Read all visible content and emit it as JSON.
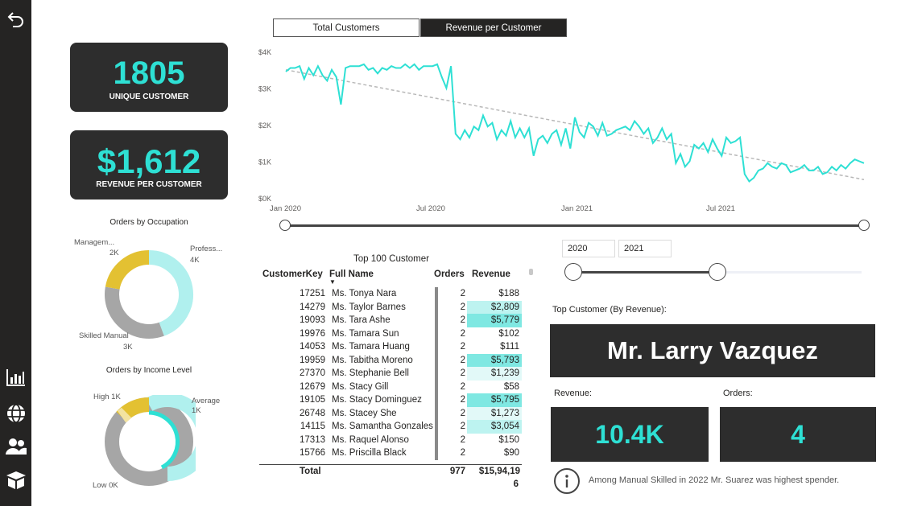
{
  "sidebar": {
    "icons": [
      "back-arrow-icon",
      "bar-chart-icon",
      "globe-icon",
      "users-icon",
      "box-icon"
    ]
  },
  "kpis": {
    "unique_customers": {
      "value": "1805",
      "label": "UNIQUE CUSTOMER"
    },
    "revenue_per_customer": {
      "value": "$1,612",
      "label": "REVENUE PER CUSTOMER"
    }
  },
  "tabs": {
    "total_customers": "Total Customers",
    "revenue_per_customer": "Revenue per Customer",
    "active": "Revenue per Customer"
  },
  "line_chart": {
    "y_ticks": [
      "$4K",
      "$3K",
      "$2K",
      "$1K",
      "$0K"
    ],
    "x_ticks": [
      "Jan 2020",
      "Jul 2020",
      "Jan 2021",
      "Jul 2021"
    ]
  },
  "occupation_chart": {
    "title": "Orders by Occupation",
    "labels": {
      "management": "Managem...",
      "management_value": "2K",
      "professional": "Profess...",
      "professional_value": "4K",
      "skilled": "Skilled Manual",
      "skilled_value": "3K"
    }
  },
  "income_chart": {
    "title": "Orders by Income Level",
    "labels": {
      "high": "High 1K",
      "average": "Average",
      "average_value": "1K",
      "low": "Low 0K"
    }
  },
  "table": {
    "title": "Top 100 Customer",
    "headers": [
      "CustomerKey",
      "Full Name",
      "Orders",
      "Revenue"
    ],
    "rows": [
      [
        "17251",
        "Ms. Tonya Nara",
        "2",
        "$188"
      ],
      [
        "14279",
        "Ms. Taylor Barnes",
        "2",
        "$2,809"
      ],
      [
        "19093",
        "Ms. Tara Ashe",
        "2",
        "$5,779"
      ],
      [
        "19976",
        "Ms. Tamara Sun",
        "2",
        "$102"
      ],
      [
        "14053",
        "Ms. Tamara Huang",
        "2",
        "$111"
      ],
      [
        "19959",
        "Ms. Tabitha Moreno",
        "2",
        "$5,793"
      ],
      [
        "27370",
        "Ms. Stephanie Bell",
        "2",
        "$1,239"
      ],
      [
        "12679",
        "Ms. Stacy Gill",
        "2",
        "$58"
      ],
      [
        "19105",
        "Ms. Stacy Dominguez",
        "2",
        "$5,795"
      ],
      [
        "26748",
        "Ms. Stacey She",
        "2",
        "$1,273"
      ],
      [
        "14115",
        "Ms. Samantha Gonzales",
        "2",
        "$3,054"
      ],
      [
        "17313",
        "Ms. Raquel Alonso",
        "2",
        "$150"
      ],
      [
        "15766",
        "Ms. Priscilla Black",
        "2",
        "$90"
      ]
    ],
    "total_label": "Total",
    "total_orders": "977",
    "total_revenue": "$15,94,19",
    "total_revenue_tail": "6"
  },
  "slicer": {
    "start_year": "2020",
    "end_year": "2021"
  },
  "top_customer": {
    "heading": "Top Customer (By Revenue):",
    "name": "Mr. Larry Vazquez",
    "revenue_label": "Revenue:",
    "revenue_value": "10.4K",
    "orders_label": "Orders:",
    "orders_value": "4"
  },
  "insight": {
    "text": "Among Manual Skilled in 2022 Mr. Suarez was highest spender."
  },
  "colors": {
    "accent": "#2ee0d4",
    "dark_card": "#2d2d2d",
    "sidebar": "#252423",
    "gold": "#e3c132",
    "gray": "#a6a6a6",
    "light_teal": "#b0f0ee"
  },
  "chart_data": [
    {
      "type": "line",
      "x_range": [
        "2020-01",
        "2021-12"
      ],
      "ylim": [
        0,
        4000
      ],
      "x_tick_labels": [
        "Jan 2020",
        "Jul 2020",
        "Jan 2021",
        "Jul 2021"
      ],
      "y_tick_labels": [
        "$4K",
        "$3K",
        "$2K",
        "$1K",
        "$0K"
      ],
      "grid": false,
      "series": [
        {
          "values": [
            3450,
            3550,
            3550,
            3600,
            3250,
            3550,
            3350,
            3600,
            3350,
            3200,
            3500,
            3300,
            2550,
            3550,
            3600,
            3600,
            3600,
            3650,
            3500,
            3550,
            3400,
            3550,
            3500,
            3600,
            3550,
            3550,
            3650,
            3550,
            3650,
            3500,
            3600,
            3600,
            3600,
            3650,
            3300,
            3000,
            3600,
            1750,
            1600,
            1850,
            1650,
            1950,
            1850,
            2250,
            1950,
            2050,
            1600,
            1850,
            1700,
            2100,
            1650,
            1900,
            1650,
            1900,
            1150,
            1600,
            1700,
            1500,
            1750,
            1850,
            1450,
            1900,
            1350,
            2200,
            1800,
            1650,
            2050,
            1950,
            1700,
            2050,
            1700,
            1750,
            1850,
            1900,
            1950,
            1850,
            2100,
            1950,
            1750,
            1900,
            1500,
            1650,
            1900,
            1600,
            1750,
            950,
            1200,
            850,
            1000,
            1450,
            1350,
            1500,
            1250,
            1600,
            1350,
            1150,
            1650,
            1500,
            1550,
            1650,
            650,
            450,
            550,
            750,
            800,
            950,
            850,
            800,
            950,
            900,
            700,
            750,
            800,
            900,
            750,
            750,
            850,
            650,
            700,
            850,
            750,
            900,
            800,
            950,
            1050,
            1000,
            950
          ]
        },
        {
          "values": [
            3500,
            500
          ]
        }
      ]
    },
    {
      "type": "pie",
      "title": "Orders by Occupation",
      "categories": [
        "Professional",
        "Skilled Manual",
        "Management"
      ],
      "values": [
        4000,
        3000,
        2000
      ]
    },
    {
      "type": "pie",
      "title": "Orders by Income Level",
      "categories": [
        "Average",
        "Low",
        "High"
      ],
      "values": [
        1000,
        0,
        1000
      ]
    }
  ]
}
